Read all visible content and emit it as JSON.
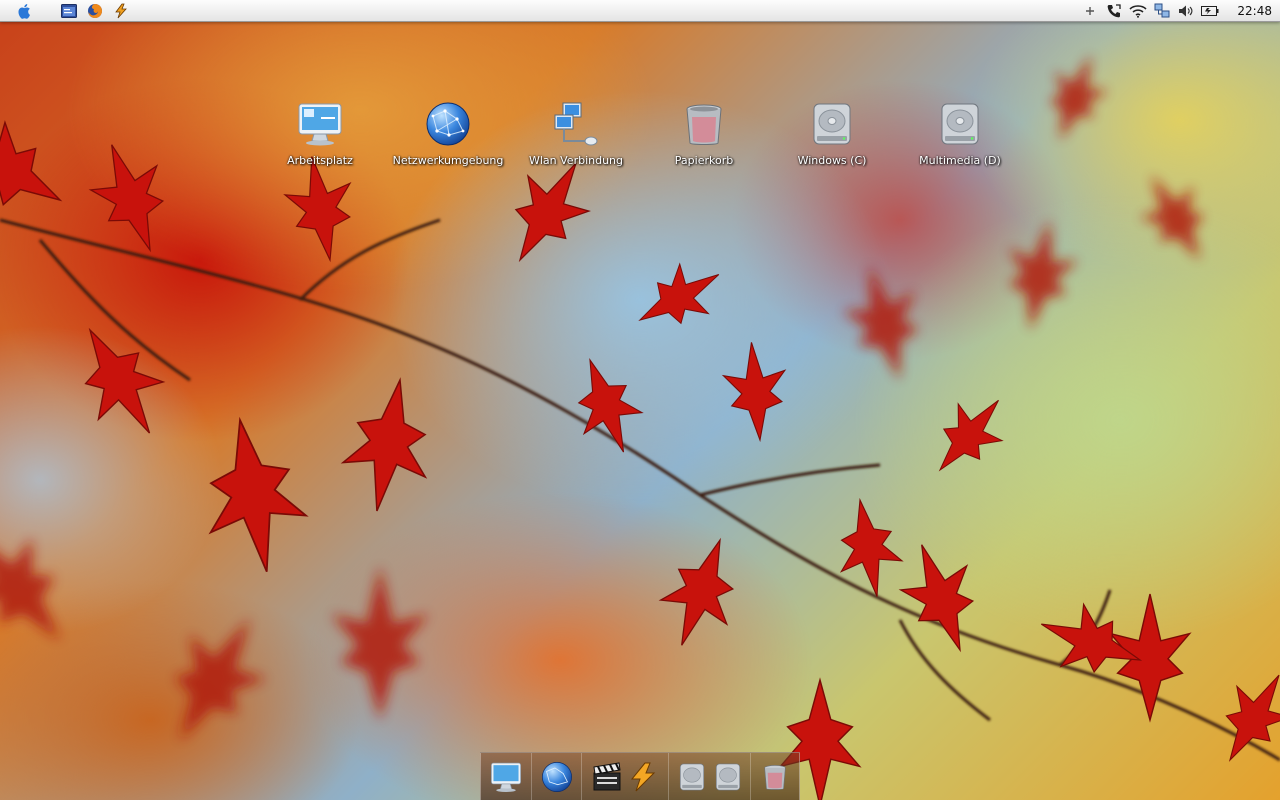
{
  "menubar": {
    "clock": "22:48",
    "left_icons": [
      "apple-menu-icon",
      "terminal-window-icon",
      "firefox-icon",
      "winamp-icon"
    ],
    "tray_icons": [
      "plus-icon",
      "phone-icon",
      "wifi-icon",
      "network-icon",
      "volume-icon",
      "battery-icon"
    ]
  },
  "desktop": {
    "icons": [
      {
        "label": "Arbeitsplatz",
        "icon": "computer-icon"
      },
      {
        "label": "Netzwerkumgebung",
        "icon": "globe-network-icon"
      },
      {
        "label": "Wlan Verbindung",
        "icon": "network-connection-icon"
      },
      {
        "label": "Papierkorb",
        "icon": "trash-icon"
      },
      {
        "label": "Windows (C)",
        "icon": "hard-drive-icon"
      },
      {
        "label": "Multimedia (D)",
        "icon": "hard-drive-icon"
      }
    ]
  },
  "dock": {
    "items": [
      "computer-icon",
      "globe-network-icon",
      "movie-clapper-icon",
      "winamp-icon",
      "hard-drive-icon",
      "hard-drive-icon",
      "trash-icon"
    ]
  },
  "colors": {
    "menubar_top": "#fdfdfd",
    "menubar_bottom": "#e4e4e4",
    "label_text": "#ffffff",
    "leaf_red": "#c8120c"
  }
}
